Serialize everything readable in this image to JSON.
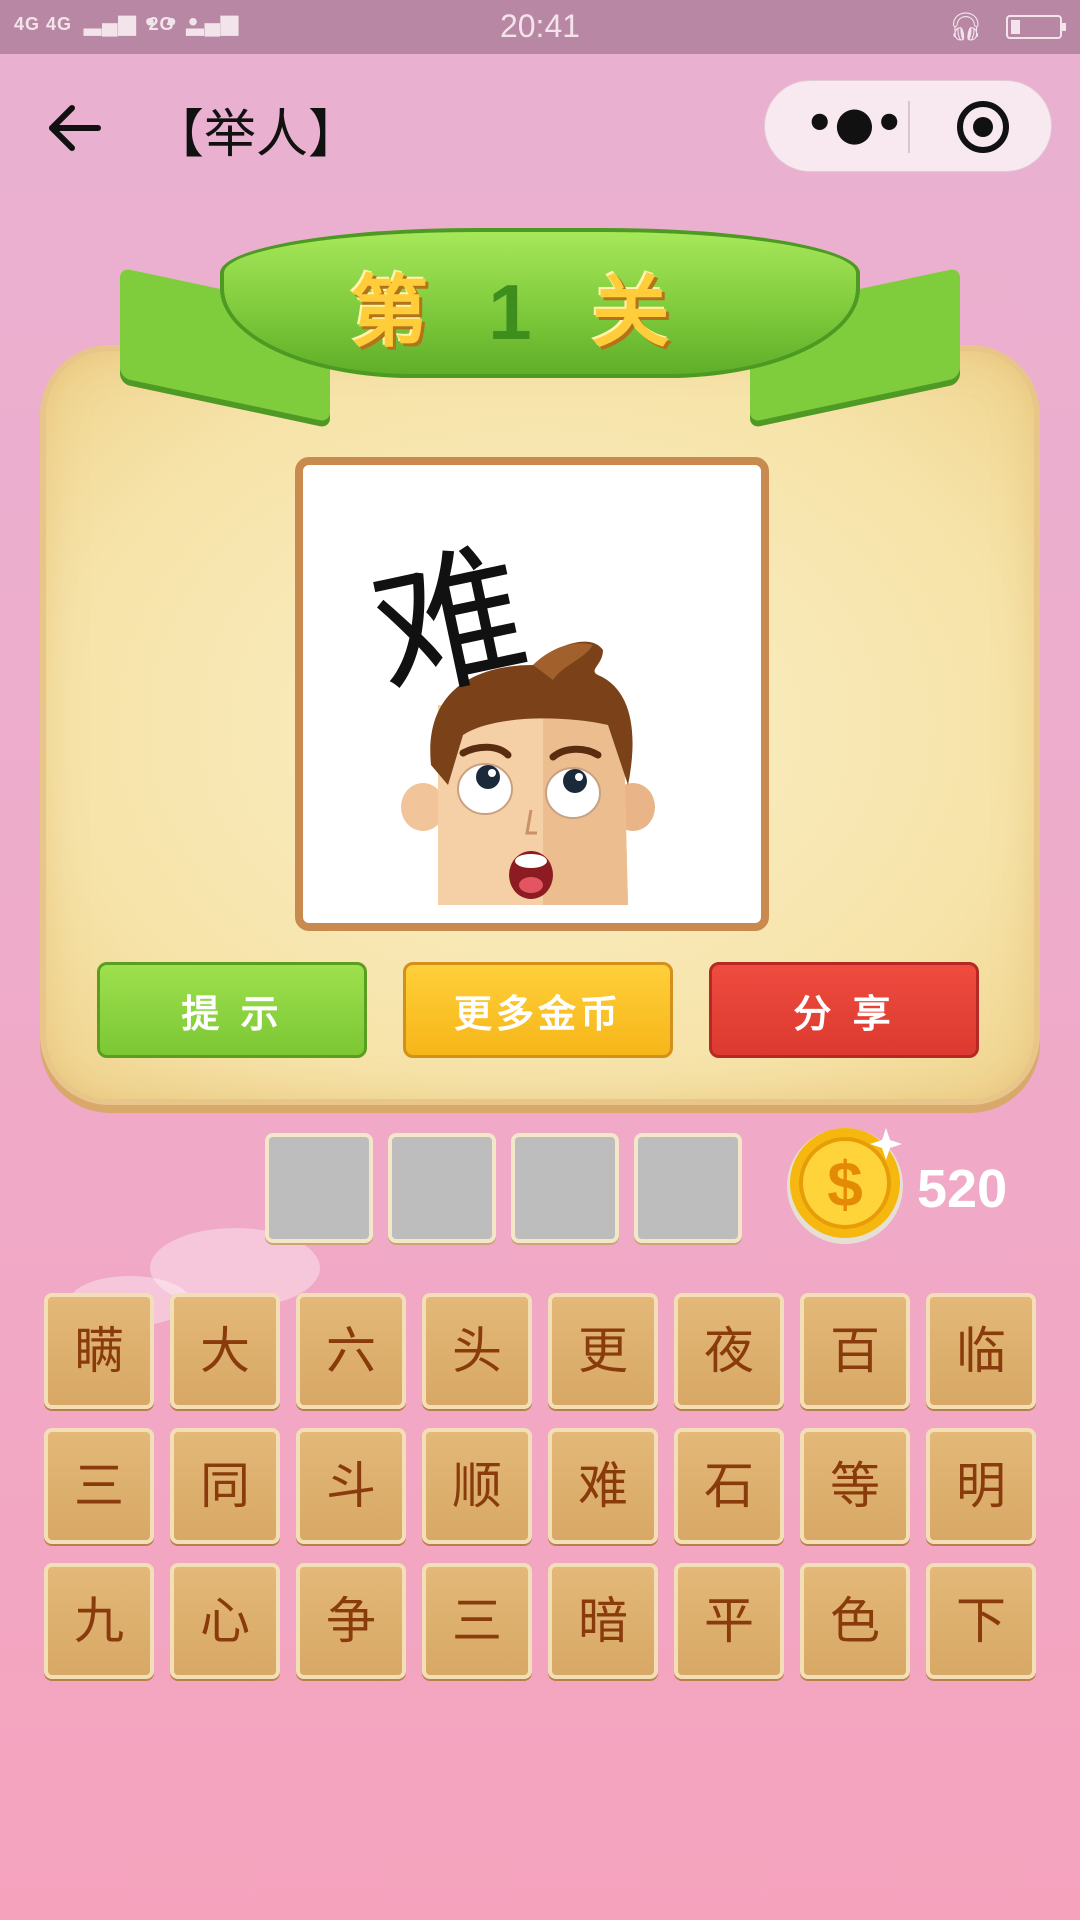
{
  "status_bar": {
    "signal_1": "4G",
    "signal_2": "4G",
    "signal_3": "2G",
    "dots": "• • •",
    "time": "20:41"
  },
  "nav": {
    "title": "【举人】",
    "more_icon": "more-dots-icon",
    "close_icon": "record-circle-icon"
  },
  "level": {
    "prefix": "第",
    "number": "1",
    "suffix": "关"
  },
  "puzzle": {
    "image_text": "难"
  },
  "buttons": {
    "hint": "提 示",
    "more_coins": "更多金币",
    "share": "分 享"
  },
  "coins": {
    "count": "520"
  },
  "answer_slots": 4,
  "chars": [
    [
      "瞒",
      "大",
      "六",
      "头",
      "更",
      "夜",
      "百",
      "临"
    ],
    [
      "三",
      "同",
      "斗",
      "顺",
      "难",
      "石",
      "等",
      "明"
    ],
    [
      "九",
      "心",
      "争",
      "三",
      "暗",
      "平",
      "色",
      "下"
    ]
  ],
  "colors": {
    "hint": "#7cc734",
    "more_coins": "#f6b619",
    "share": "#dc3a30",
    "tile_text": "#8a3b0c"
  }
}
